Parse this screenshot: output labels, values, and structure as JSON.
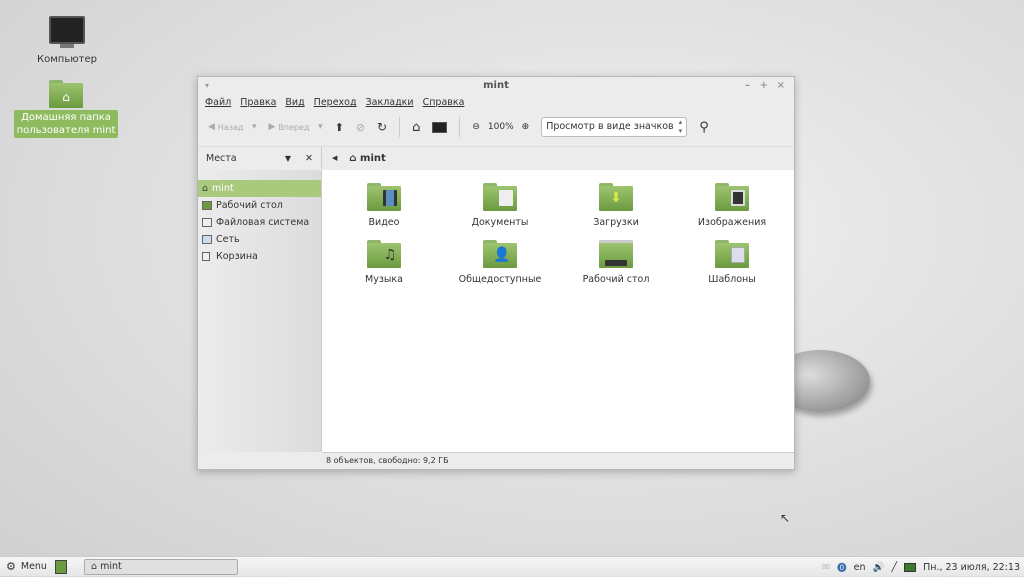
{
  "desktop": {
    "icons": [
      {
        "label": "Компьютер",
        "icon": "computer-icon"
      },
      {
        "label": "Домашняя папка пользователя mint",
        "icon": "home-folder-icon"
      }
    ]
  },
  "window": {
    "title": "mint",
    "menu": [
      "Файл",
      "Правка",
      "Вид",
      "Переход",
      "Закладки",
      "Справка"
    ],
    "toolbar": {
      "back": "Назад",
      "forward": "Вперед",
      "zoom": "100%",
      "view_mode": "Просмотр в виде значков"
    },
    "places_label": "Места",
    "breadcrumb": "mint",
    "sidebar": [
      {
        "label": "mint",
        "selected": true
      },
      {
        "label": "Рабочий стол"
      },
      {
        "label": "Файловая система"
      },
      {
        "label": "Сеть"
      },
      {
        "label": "Корзина"
      }
    ],
    "files": [
      {
        "name": "Видео",
        "emblem": "film-icon"
      },
      {
        "name": "Документы",
        "emblem": "document-icon"
      },
      {
        "name": "Загрузки",
        "emblem": "download-arrow-icon"
      },
      {
        "name": "Изображения",
        "emblem": "pictures-icon"
      },
      {
        "name": "Музыка",
        "emblem": "music-note-icon"
      },
      {
        "name": "Общедоступные",
        "emblem": "person-icon"
      },
      {
        "name": "Рабочий стол",
        "emblem": "desktop-icon"
      },
      {
        "name": "Шаблоны",
        "emblem": "template-icon"
      }
    ],
    "status": "8 объектов, свободно: 9,2 ГБ"
  },
  "taskbar": {
    "menu": "Menu",
    "task": "mint",
    "lang": "en",
    "clock": "Пн., 23 июля, 22:13"
  },
  "colors": {
    "accent": "#a9c97c",
    "folder": "#7fab52"
  }
}
